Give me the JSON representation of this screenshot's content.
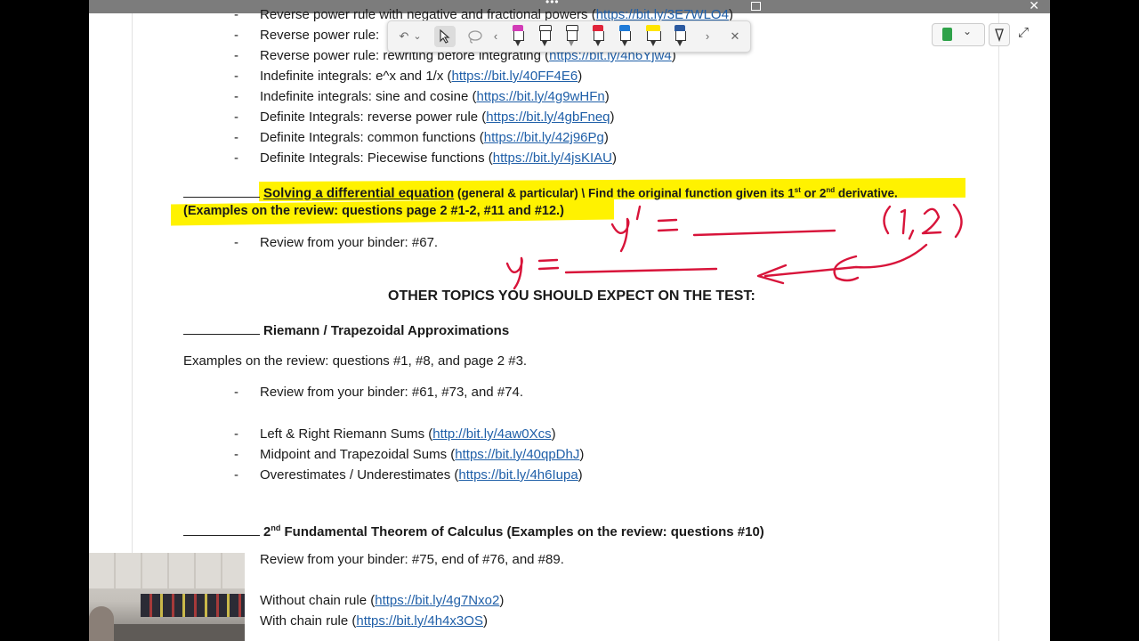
{
  "window": {
    "close_glyph": "✕",
    "menu_dots": "•••"
  },
  "ink_toolbar": {
    "undo_icon": "undo-icon",
    "chevron_down": "⌄",
    "select_icon": "pointer-icon",
    "lasso_icon": "lasso-icon",
    "prev": "‹",
    "next": "›",
    "close": "✕",
    "pens": [
      "#d23cb7",
      "#ffffff",
      "#ffffff",
      "#e0243a",
      "#1f7bd8",
      "#ffe500",
      "#2c5aa0"
    ]
  },
  "right_tools": {
    "notebook_color": "#2fa24a",
    "chevron": "⌄",
    "pen_icon": "pen-icon",
    "expand": "⤢"
  },
  "list1": [
    {
      "text": "Reverse power rule with negative and fractional powers (",
      "link": "https://bit.ly/3E7WLO4",
      "close": ")"
    },
    {
      "text": "Reverse power rule: ",
      "link": "",
      "close": ""
    },
    {
      "text": "Reverse power rule: rewriting before integrating (",
      "link": "https://bit.ly/4h6Yjw4",
      "close": ")"
    },
    {
      "text": "Indefinite integrals:  e^x and 1/x (",
      "link": "https://bit.ly/40FF4E6",
      "close": ")"
    },
    {
      "text": "Indefinite integrals:  sine and cosine (",
      "link": "https://bit.ly/4g9wHFn",
      "close": ")"
    },
    {
      "text": "Definite Integrals:  reverse power rule (",
      "link": "https://bit.ly/4gbFneq",
      "close": ")"
    },
    {
      "text": "Definite Integrals: common functions (",
      "link": "https://bit.ly/42j96Pg",
      "close": ")"
    },
    {
      "text": "Definite Integrals:  Piecewise functions (",
      "link": "https://bit.ly/4jsKIAU",
      "close": ")"
    }
  ],
  "diffeq": {
    "title": "Solving a differential equation",
    "line1_rest": " (general & particular) \\ Find the original function given its 1",
    "sup1": "st",
    "or": " or 2",
    "sup2": "nd",
    "end": " derivative.",
    "line2": "(Examples on the review: questions page 2 #1-2, #11 and #12.)",
    "binder": "Review from your binder:  #67."
  },
  "ink": {
    "y_prime": "y' =",
    "y": "y =",
    "point": "(1,2)",
    "color": "#d8143a"
  },
  "other_topics": "OTHER TOPICS YOU SHOULD EXPECT ON THE TEST:",
  "riemann": {
    "title": "Riemann / Trapezoidal Approximations",
    "examples": "Examples on the review: questions #1, #8, and page 2 #3.",
    "binder": "Review from your binder:  #61, #73, and #74.",
    "links": [
      {
        "text": "Left & Right Riemann Sums (",
        "link": "http://bit.ly/4aw0Xcs",
        "close": ")"
      },
      {
        "text": "Midpoint and Trapezoidal Sums (",
        "link": "https://bit.ly/40qpDhJ",
        "close": ")"
      },
      {
        "text": "Overestimates / Underestimates (",
        "link": "https://bit.ly/4h6Iupa",
        "close": ")"
      }
    ]
  },
  "ftc": {
    "pre": "2",
    "sup": "nd",
    "title": " Fundamental Theorem of Calculus (Examples on the review: questions #10)",
    "binder": "Review from your binder:  #75, end of #76, and #89.",
    "links": [
      {
        "text": "Without chain rule (",
        "link": "https://bit.ly/4g7Nxo2",
        "close": ")"
      },
      {
        "text": "With chain rule (",
        "link": "https://bit.ly/4h4x3OS",
        "close": ")"
      }
    ]
  },
  "bullet": "-"
}
